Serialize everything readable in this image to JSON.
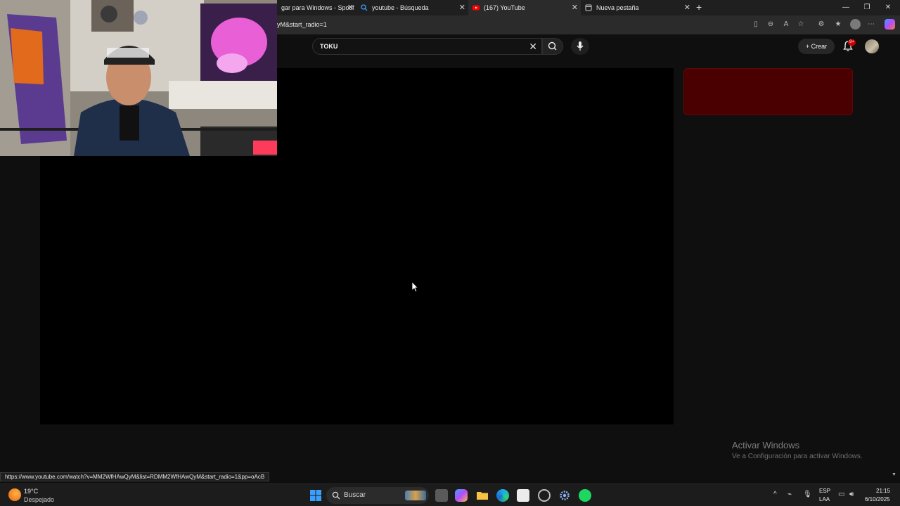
{
  "browser": {
    "tabs": [
      {
        "title": "gar para Windows - Spotif",
        "active": false
      },
      {
        "title": "youtube - Búsqueda",
        "active": false
      },
      {
        "title": "(167) YouTube",
        "active": true
      },
      {
        "title": "Nueva pestaña",
        "active": false
      }
    ],
    "new_tab_label": "+",
    "address": "yM&start_radio=1",
    "status_link": "https://www.youtube.com/watch?v=MM2WfHAwQyM&list=RDMM2WfHAwQyM&start_radio=1&pp=oAcB"
  },
  "youtube": {
    "search_value": "TOKU",
    "create_label": "Crear",
    "notifications_badge": "9+"
  },
  "watermark": {
    "title": "Activar Windows",
    "subtitle": "Ve a Configuración para activar Windows."
  },
  "taskbar": {
    "weather_temp": "19°C",
    "weather_desc": "Despejado",
    "search_label": "Buscar",
    "lang_top": "ESP",
    "lang_bottom": "LAA",
    "time": "21:15",
    "date": "6/10/2025"
  },
  "colors": {
    "accent_red": "#cc0000",
    "player_bg": "#000000",
    "page_bg": "#0f0f0f"
  }
}
